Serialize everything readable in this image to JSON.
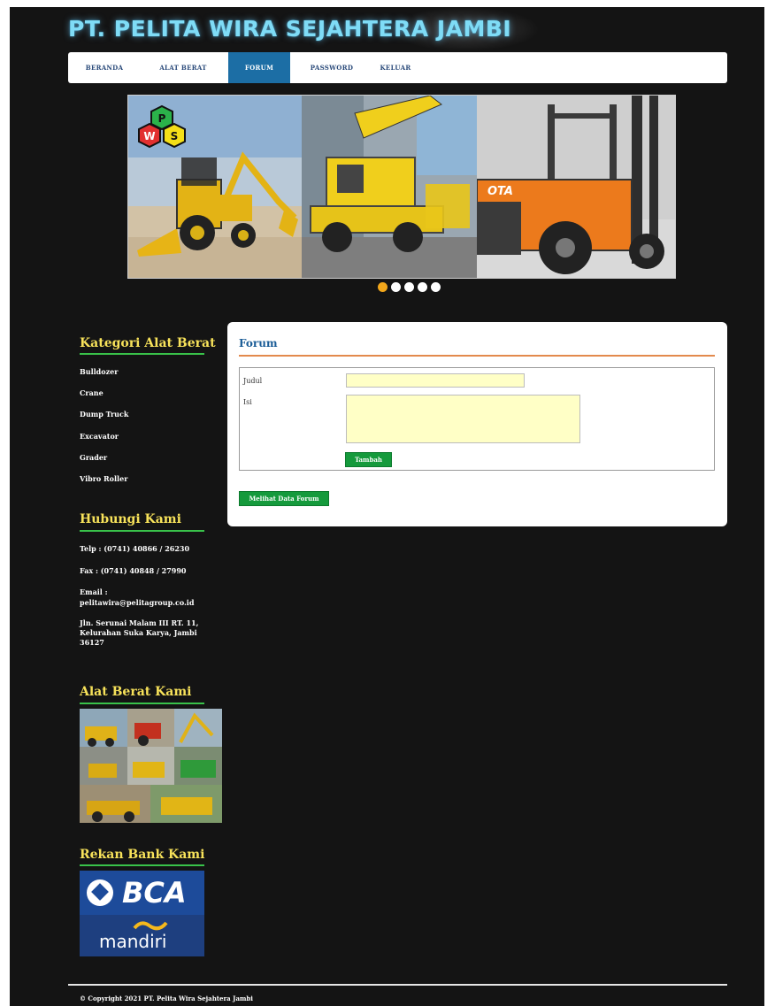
{
  "site": {
    "title": "PT. PELITA WIRA SEJAHTERA JAMBI"
  },
  "nav": {
    "items": [
      {
        "label": "BERANDA",
        "active": false
      },
      {
        "label": "ALAT BERAT",
        "active": false
      },
      {
        "label": "FORUM",
        "active": true
      },
      {
        "label": "PASSWORD",
        "active": false
      },
      {
        "label": "KELUAR",
        "active": false
      }
    ]
  },
  "slider": {
    "logo_letters": [
      "P",
      "W",
      "S"
    ],
    "forklift_brand": "OTA",
    "dots": 5,
    "active_dot": 1
  },
  "sidebar": {
    "kategori": {
      "heading": "Kategori Alat Berat",
      "items": [
        "Bulldozer",
        "Crane",
        "Dump Truck",
        "Excavator",
        "Grader",
        "Vibro Roller"
      ]
    },
    "hubungi": {
      "heading": "Hubungi Kami",
      "telp": "Telp : (0741) 40866 / 26230",
      "fax": "Fax : (0741) 40848 / 27990",
      "email_label": "Email :",
      "email": "pelitawira@pelitagroup.co.id",
      "address": "Jln. Serunai Malam III RT. 11, Kelurahan Suka Karya, Jambi 36127"
    },
    "alat": {
      "heading": "Alat Berat Kami"
    },
    "bank": {
      "heading": "Rekan Bank Kami",
      "bca": "BCA",
      "mandiri": "mandiri"
    }
  },
  "forum": {
    "title": "Forum",
    "judul_label": "Judul",
    "isi_label": "Isi",
    "judul_value": "",
    "isi_value": "",
    "submit_label": "Tambah",
    "view_button": "Melihat Data Forum"
  },
  "footer": {
    "text": "© Copyright 2021 PT. Pelita Wira Sejahtera Jambi"
  },
  "colors": {
    "background": "#141414",
    "title": "#7fdcf6",
    "nav_active": "#1c6ea5",
    "sidebar_heading": "#f7e25a",
    "sidebar_rule": "#39c24a",
    "panel_title": "#1b5d97",
    "panel_rule": "#e38a4d",
    "button": "#159a3c",
    "field": "#ffffc6",
    "dot_active": "#f2a71b"
  }
}
